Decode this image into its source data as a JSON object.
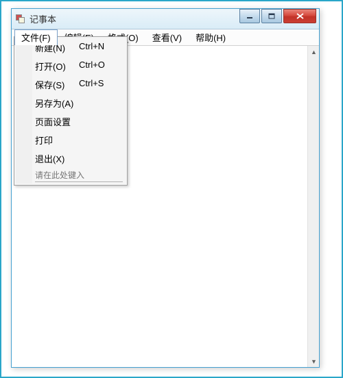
{
  "window": {
    "title": "记事本"
  },
  "menubar": {
    "items": [
      {
        "label": "文件(F)",
        "active": true
      },
      {
        "label": "编辑(E)",
        "active": false
      },
      {
        "label": "格式(O)",
        "active": false
      },
      {
        "label": "查看(V)",
        "active": false
      },
      {
        "label": "帮助(H)",
        "active": false
      }
    ]
  },
  "file_menu": {
    "items": [
      {
        "label": "新建(N)",
        "shortcut": "Ctrl+N"
      },
      {
        "label": "打开(O)",
        "shortcut": "Ctrl+O"
      },
      {
        "label": "保存(S)",
        "shortcut": "Ctrl+S"
      },
      {
        "label": "另存为(A)",
        "shortcut": ""
      },
      {
        "label": "页面设置",
        "shortcut": ""
      },
      {
        "label": "打印",
        "shortcut": ""
      },
      {
        "label": "退出(X)",
        "shortcut": ""
      }
    ],
    "input_placeholder": "请在此处键入"
  },
  "textarea": {
    "value": ""
  }
}
